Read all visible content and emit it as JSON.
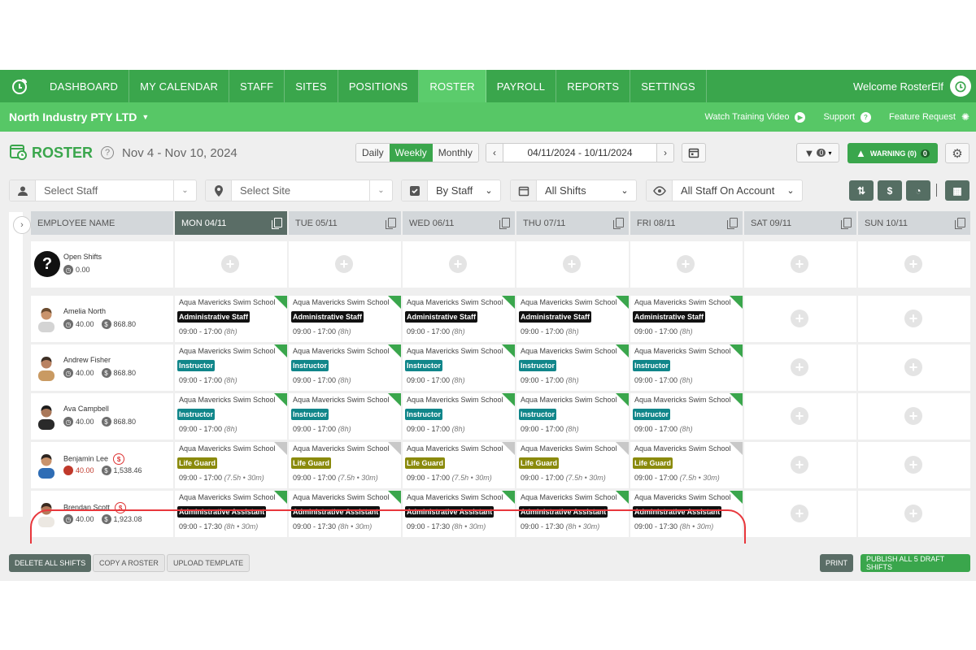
{
  "nav": {
    "items": [
      {
        "label": "DASHBOARD"
      },
      {
        "label": "MY CALENDAR"
      },
      {
        "label": "STAFF"
      },
      {
        "label": "SITES"
      },
      {
        "label": "POSITIONS"
      },
      {
        "label": "ROSTER",
        "active": true
      },
      {
        "label": "PAYROLL"
      },
      {
        "label": "REPORTS"
      },
      {
        "label": "SETTINGS"
      }
    ],
    "welcome": "Welcome RosterElf"
  },
  "subnav": {
    "company": "North Industry PTY LTD",
    "links": {
      "training": "Watch Training Video",
      "support": "Support",
      "feature": "Feature Request"
    }
  },
  "header": {
    "title": "ROSTER",
    "date_range": "Nov 4 - Nov 10, 2024",
    "views": {
      "daily": "Daily",
      "weekly": "Weekly",
      "monthly": "Monthly"
    },
    "date_input": "04/11/2024 - 10/11/2024",
    "filter_count": "0",
    "warning_label": "WARNING (0)",
    "warning_count": "0"
  },
  "filters": {
    "staff_placeholder": "Select Staff",
    "site_placeholder": "Select Site",
    "group_by": "By Staff",
    "shifts": "All Shifts",
    "account": "All Staff On Account"
  },
  "grid": {
    "employee_header": "EMPLOYEE NAME",
    "days": [
      "MON 04/11",
      "TUE 05/11",
      "WED 06/11",
      "THU 07/11",
      "FRI 08/11",
      "SAT 09/11",
      "SUN 10/11"
    ],
    "open_shifts": {
      "label": "Open Shifts",
      "hours": "0.00"
    },
    "employees": [
      {
        "name": "Amelia North",
        "hours": "40.00",
        "cost": "868.80",
        "site": "Aqua Mavericks Swim School",
        "position": "Administrative Staff",
        "pos_color": "#111111",
        "time": "09:00 - 17:00",
        "dur": "(8h)",
        "status": "green",
        "swap": false,
        "hours_alert": false
      },
      {
        "name": "Andrew Fisher",
        "hours": "40.00",
        "cost": "868.80",
        "site": "Aqua Mavericks Swim School",
        "position": "Instructor",
        "pos_color": "#11868a",
        "time": "09:00 - 17:00",
        "dur": "(8h)",
        "status": "green",
        "swap": false,
        "hours_alert": false
      },
      {
        "name": "Ava Campbell",
        "hours": "40.00",
        "cost": "868.80",
        "site": "Aqua Mavericks Swim School",
        "position": "Instructor",
        "pos_color": "#11868a",
        "time": "09:00 - 17:00",
        "dur": "(8h)",
        "status": "green",
        "swap": false,
        "hours_alert": false
      },
      {
        "name": "Benjamin Lee",
        "hours": "40.00",
        "cost": "1,538.46",
        "site": "Aqua Mavericks Swim School",
        "position": "Life Guard",
        "pos_color": "#8a8a0c",
        "time": "09:00 - 17:00",
        "dur": "(7.5h • 30m)",
        "status": "grey",
        "swap": true,
        "hours_alert": true
      },
      {
        "name": "Brendan Scott",
        "hours": "40.00",
        "cost": "1,923.08",
        "site": "Aqua Mavericks Swim School",
        "position": "Administrative Assistant",
        "pos_color": "#111111",
        "time": "09:00 - 17:30",
        "dur": "(8h • 30m)",
        "status": "green",
        "swap": true,
        "hours_alert": false
      }
    ],
    "highlight_color": "#e8373c"
  },
  "footer": {
    "delete_all": "DELETE ALL SHIFTS",
    "copy_roster": "COPY A ROSTER",
    "upload_template": "UPLOAD TEMPLATE",
    "print": "PRINT",
    "publish": "PUBLISH ALL 5 DRAFT SHIFTS"
  },
  "colors": {
    "brand": "#3aa64c",
    "brand_light": "#57c766",
    "dark_slate": "#5a6d66"
  }
}
